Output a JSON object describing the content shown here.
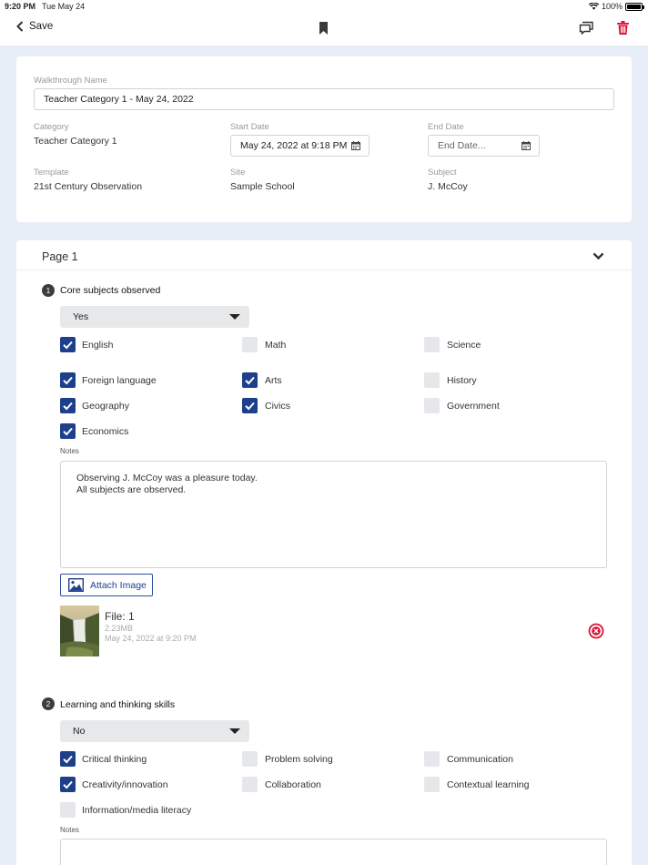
{
  "statusbar": {
    "time": "9:20 PM",
    "date": "Tue May 24",
    "battery": "100%"
  },
  "navbar": {
    "back_label": "Save"
  },
  "details": {
    "walkthrough_name_label": "Walkthrough Name",
    "walkthrough_name_value": "Teacher Category 1  - May 24, 2022",
    "category_label": "Category",
    "category_value": "Teacher Category 1",
    "start_date_label": "Start Date",
    "start_date_value": "May 24, 2022 at 9:18 PM",
    "end_date_label": "End Date",
    "end_date_placeholder": "End Date...",
    "template_label": "Template",
    "template_value": "21st Century Observation",
    "site_label": "Site",
    "site_value": "Sample School",
    "subject_label": "Subject",
    "subject_value": "J. McCoy"
  },
  "page": {
    "title": "Page 1"
  },
  "questions": [
    {
      "number": "1",
      "text": "Core subjects observed",
      "selected": "Yes",
      "options": [
        {
          "label": "English",
          "checked": true
        },
        {
          "label": "Math",
          "checked": false
        },
        {
          "label": "Science",
          "checked": false
        },
        {
          "label": "Foreign language",
          "checked": true
        },
        {
          "label": "Arts",
          "checked": true
        },
        {
          "label": "History",
          "checked": false
        },
        {
          "label": "Geography",
          "checked": true
        },
        {
          "label": "Civics",
          "checked": true
        },
        {
          "label": "Government",
          "checked": false
        },
        {
          "label": "Economics",
          "checked": true
        }
      ],
      "notes_label": "Notes",
      "notes_line1": "Observing J. McCoy was a pleasure today.",
      "notes_line2": "All subjects are observed.",
      "attach_label": "Attach Image",
      "file": {
        "name": "File: 1",
        "size": "2.23MB",
        "date": "May 24, 2022 at 9:20 PM"
      }
    },
    {
      "number": "2",
      "text": "Learning and thinking skills",
      "selected": "No",
      "options": [
        {
          "label": "Critical thinking",
          "checked": true
        },
        {
          "label": "Problem solving",
          "checked": false
        },
        {
          "label": "Communication",
          "checked": false
        },
        {
          "label": "Creativity/innovation",
          "checked": true
        },
        {
          "label": "Collaboration",
          "checked": false
        },
        {
          "label": "Contextual learning",
          "checked": false
        },
        {
          "label": "Information/media literacy",
          "checked": false
        }
      ],
      "notes_label": "Notes"
    }
  ],
  "colors": {
    "accent": "#1e3f8c",
    "danger": "#d8143a",
    "background": "#e8eef8"
  }
}
